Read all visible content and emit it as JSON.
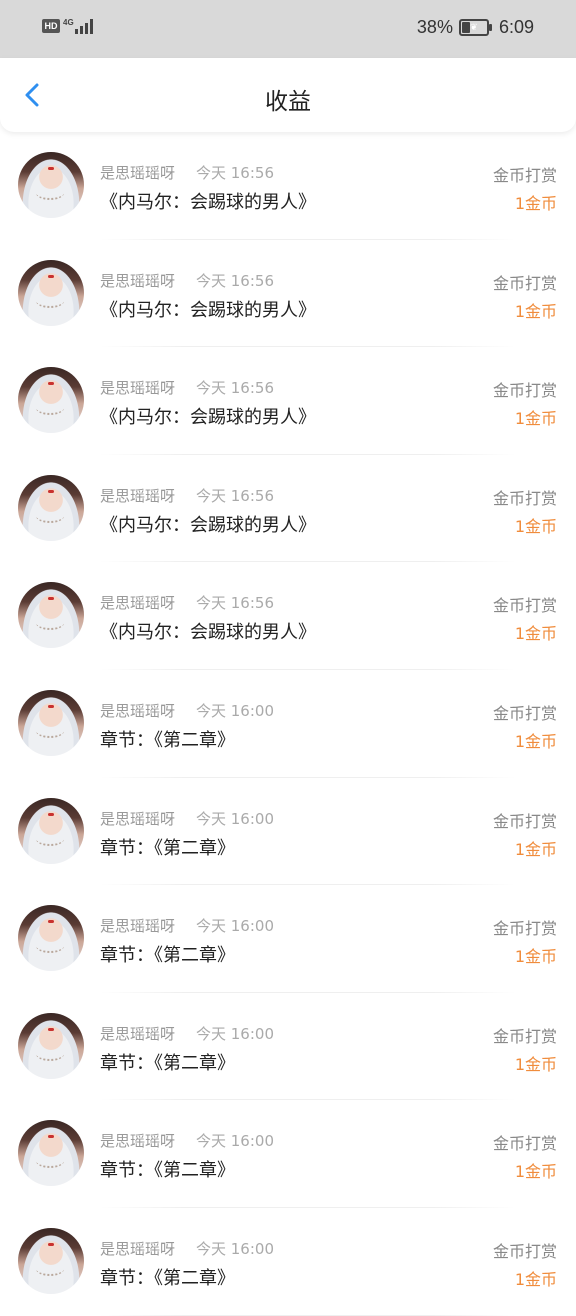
{
  "status_bar": {
    "hd": "HD",
    "network": "4G",
    "battery": "38%",
    "battery_level": 0.38,
    "time": "6:09"
  },
  "navbar": {
    "back_icon": "chevron-left-icon",
    "title": "收益"
  },
  "colors": {
    "accent_blue": "#2f8ff0",
    "amount_orange": "#f08c3c"
  },
  "items": [
    {
      "name": "是思瑶瑶呀",
      "time": "今天 16:56",
      "title": "《内马尔：会踢球的男人》",
      "type": "金币打赏",
      "amount": "1金币"
    },
    {
      "name": "是思瑶瑶呀",
      "time": "今天 16:56",
      "title": "《内马尔：会踢球的男人》",
      "type": "金币打赏",
      "amount": "1金币"
    },
    {
      "name": "是思瑶瑶呀",
      "time": "今天 16:56",
      "title": "《内马尔：会踢球的男人》",
      "type": "金币打赏",
      "amount": "1金币"
    },
    {
      "name": "是思瑶瑶呀",
      "time": "今天 16:56",
      "title": "《内马尔：会踢球的男人》",
      "type": "金币打赏",
      "amount": "1金币"
    },
    {
      "name": "是思瑶瑶呀",
      "time": "今天 16:56",
      "title": "《内马尔：会踢球的男人》",
      "type": "金币打赏",
      "amount": "1金币"
    },
    {
      "name": "是思瑶瑶呀",
      "time": "今天 16:00",
      "title": "章节：《第二章》",
      "type": "金币打赏",
      "amount": "1金币"
    },
    {
      "name": "是思瑶瑶呀",
      "time": "今天 16:00",
      "title": "章节：《第二章》",
      "type": "金币打赏",
      "amount": "1金币"
    },
    {
      "name": "是思瑶瑶呀",
      "time": "今天 16:00",
      "title": "章节：《第二章》",
      "type": "金币打赏",
      "amount": "1金币"
    },
    {
      "name": "是思瑶瑶呀",
      "time": "今天 16:00",
      "title": "章节：《第二章》",
      "type": "金币打赏",
      "amount": "1金币"
    },
    {
      "name": "是思瑶瑶呀",
      "time": "今天 16:00",
      "title": "章节：《第二章》",
      "type": "金币打赏",
      "amount": "1金币"
    },
    {
      "name": "是思瑶瑶呀",
      "time": "今天 16:00",
      "title": "章节：《第二章》",
      "type": "金币打赏",
      "amount": "1金币"
    }
  ]
}
